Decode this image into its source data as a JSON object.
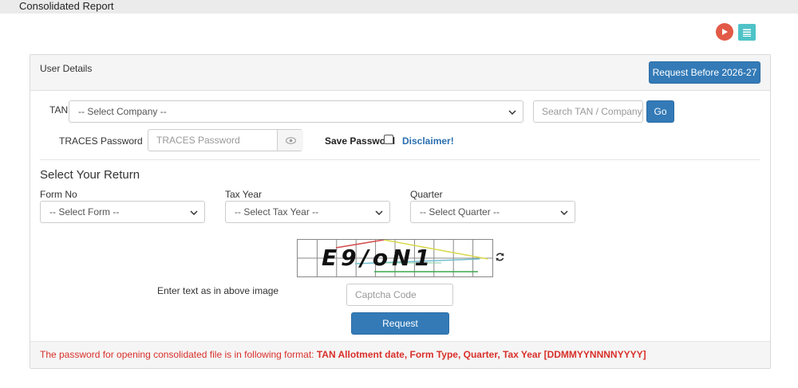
{
  "topbar": {
    "title": "Consolidated Report"
  },
  "panel": {
    "header_label": "User Details",
    "request_before_label": "Request Before 2026-27"
  },
  "tan": {
    "label": "TAN",
    "select_value": "-- Select Company --",
    "search_placeholder": "Search TAN / Company",
    "go_label": "Go"
  },
  "traces": {
    "label": "TRACES Password",
    "placeholder": "TRACES Password",
    "save_password_label": "Save Password",
    "disclaimer_label": "Disclaimer!"
  },
  "return": {
    "title": "Select Your Return",
    "form_no_label": "Form No",
    "form_no_value": "-- Select Form --",
    "tax_year_label": "Tax Year",
    "tax_year_value": "-- Select Tax Year --",
    "quarter_label": "Quarter",
    "quarter_value": "-- Select Quarter --"
  },
  "captcha": {
    "image_text": "E9/oN1",
    "instruction": "Enter text as in above image",
    "placeholder": "Captcha Code",
    "request_label": "Request"
  },
  "note": {
    "prefix": "The password for opening consolidated file is in following format: ",
    "format": "TAN Allotment date, Form Type, Quarter, Tax Year [DDMMYYNNNNYYYY]"
  },
  "colors": {
    "primary_button": "#337ab7",
    "note_text": "#d9302a",
    "play_icon": "#e25a47",
    "list_icon": "#4ec3c7"
  }
}
